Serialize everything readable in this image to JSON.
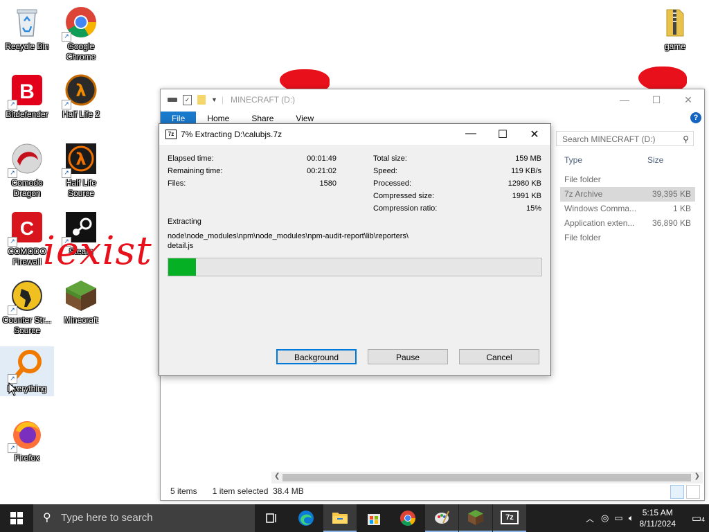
{
  "desktop": {
    "icons": [
      {
        "label": "Recycle Bin",
        "icon": "recycle-bin-icon"
      },
      {
        "label": "Google Chrome",
        "icon": "chrome-icon"
      },
      {
        "label": "Bitdefender",
        "icon": "bitdefender-icon"
      },
      {
        "label": "Half Life 2",
        "icon": "half-life-2-icon"
      },
      {
        "label": "Comodo Dragon",
        "icon": "comodo-dragon-icon"
      },
      {
        "label": "Half Life Source",
        "icon": "half-life-source-icon"
      },
      {
        "label": "COMODO Firewall",
        "icon": "comodo-firewall-icon"
      },
      {
        "label": "Steam",
        "icon": "steam-icon"
      },
      {
        "label": "Counter Str... Source",
        "icon": "counter-strike-icon"
      },
      {
        "label": "Minecraft",
        "icon": "minecraft-icon"
      },
      {
        "label": "Everything",
        "icon": "everything-icon"
      },
      {
        "label": "Firefox",
        "icon": "firefox-icon"
      },
      {
        "label": "game",
        "icon": "folder-zip-icon"
      }
    ],
    "watermark": "iexist"
  },
  "explorer": {
    "title": "MINECRAFT (D:)",
    "tabs": [
      "File",
      "Home",
      "Share",
      "View"
    ],
    "search_placeholder": "Search MINECRAFT (D:)",
    "columns": {
      "type": "Type",
      "size": "Size"
    },
    "rows": [
      {
        "type": "File folder",
        "size": ""
      },
      {
        "type": "7z Archive",
        "size": "39,395 KB"
      },
      {
        "type": "Windows Comma...",
        "size": "1 KB"
      },
      {
        "type": "Application exten...",
        "size": "36,890 KB"
      },
      {
        "type": "File folder",
        "size": ""
      }
    ],
    "status": {
      "items": "5 items",
      "selected": "1 item selected",
      "size": "38.4 MB"
    }
  },
  "dialog": {
    "title": "7% Extracting D:\\calubjs.7z",
    "app_icon_text": "7z",
    "left": [
      {
        "k": "Elapsed time:",
        "v": "00:01:49"
      },
      {
        "k": "Remaining time:",
        "v": "00:21:02"
      },
      {
        "k": "Files:",
        "v": "1580"
      }
    ],
    "right": [
      {
        "k": "Total size:",
        "v": "159 MB"
      },
      {
        "k": "Speed:",
        "v": "119 KB/s"
      },
      {
        "k": "Processed:",
        "v": "12980 KB"
      },
      {
        "k": "Compressed size:",
        "v": "1991 KB"
      },
      {
        "k": "Compression ratio:",
        "v": "15%"
      }
    ],
    "operation": "Extracting",
    "path_line1": "node\\node_modules\\npm\\node_modules\\npm-audit-report\\lib\\reporters\\",
    "path_line2": "detail.js",
    "progress": 0.075,
    "buttons": {
      "background": "Background",
      "pause": "Pause",
      "cancel": "Cancel"
    }
  },
  "taskbar": {
    "search_placeholder": "Type here to search",
    "time": "5:15 AM",
    "date": "8/11/2024",
    "notification_count": "4",
    "seven_zip_label": "7z"
  },
  "colors": {
    "progress_fill": "#06b025",
    "ribbon_file": "#1979ca",
    "watermark": "#e8101a"
  }
}
